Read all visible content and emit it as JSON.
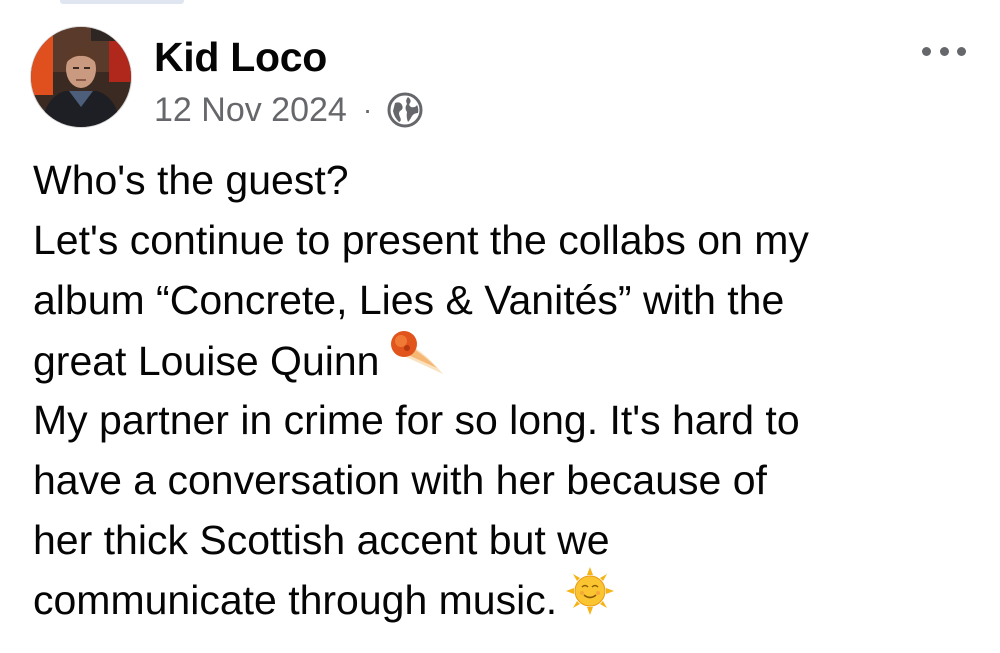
{
  "post": {
    "author": "Kid Loco",
    "date": "12 Nov 2024",
    "separator": "·",
    "privacy_icon": "globe-icon",
    "more_icon": "more-options-icon",
    "body_lines": [
      "Who's the guest?",
      "Let's continue to present the collabs on my",
      "album “Concrete, Lies & Vanités” with the",
      "great Louise Quinn",
      "My partner in crime for so long. It's hard to",
      "have a conversation with her because of",
      "her thick Scottish accent but we",
      "communicate through music."
    ],
    "emojis": {
      "comet": "comet-emoji",
      "sun": "sun-with-face-emoji"
    }
  },
  "colors": {
    "text": "#050505",
    "secondary": "#65676b",
    "background": "#ffffff"
  }
}
